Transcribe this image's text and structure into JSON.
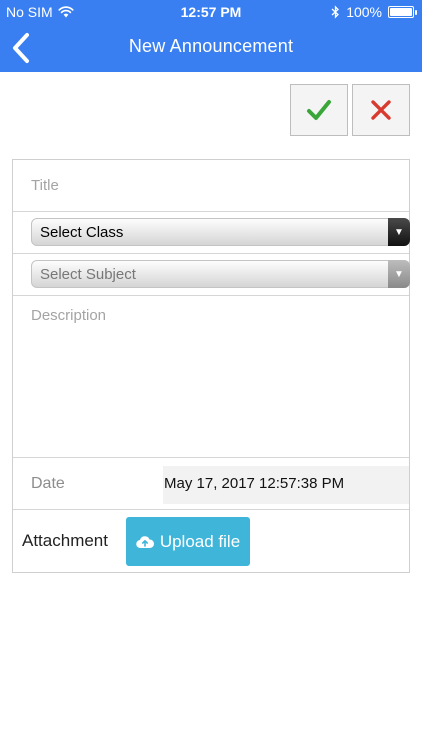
{
  "status_bar": {
    "carrier": "No SIM",
    "time": "12:57 PM",
    "battery": "100%"
  },
  "nav": {
    "title": "New Announcement",
    "back_icon": "chevron-left-icon"
  },
  "actions": {
    "confirm_icon": "checkmark-icon",
    "cancel_icon": "close-icon"
  },
  "form": {
    "title_placeholder": "Title",
    "class_select": "Select Class",
    "subject_select": "Select Subject",
    "description_placeholder": "Description",
    "date_label": "Date",
    "date_value": "May 17, 2017 12:57:38 PM",
    "attachment_label": "Attachment",
    "upload_label": "Upload file"
  },
  "colors": {
    "header": "#3a7ff1",
    "confirm": "#3aa63a",
    "cancel": "#d93a30",
    "upload": "#3fb5d9"
  }
}
